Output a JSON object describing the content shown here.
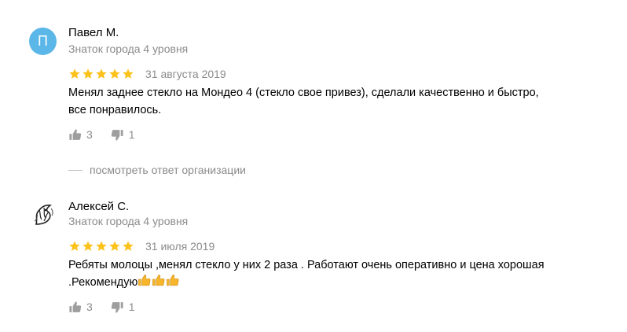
{
  "reviews": [
    {
      "avatar_letter": "П",
      "avatar_color": "#5ab7e8",
      "name": "Павел М.",
      "level": "Знаток города 4 уровня",
      "rating": 5,
      "date": "31 августа 2019",
      "text_line1": "Менял заднее стекло на Мондео 4 (стекло свое привез), сделали качественно и быстро,",
      "text_line2": "все понравилось.",
      "likes": "3",
      "dislikes": "1"
    },
    {
      "avatar_icon": "ink-drawing-avatar",
      "name": "Алексей С.",
      "level": "Знаток города 4 уровня",
      "rating": 5,
      "date": "31 июля 2019",
      "text_line1": "Ребяты молоцы ,менял стекло у них 2 раза . Работают очень оперативно и цена хорошая",
      "text_line2": ".Рекомендую",
      "text_emoji": "thumbs-up-emoji x3",
      "likes": "3",
      "dislikes": "1"
    }
  ],
  "org_answer_link": "посмотреть ответ организации",
  "colors": {
    "star": "#fcc21b",
    "muted_text": "#8b8b8b",
    "emoji": "#f6b52b"
  }
}
